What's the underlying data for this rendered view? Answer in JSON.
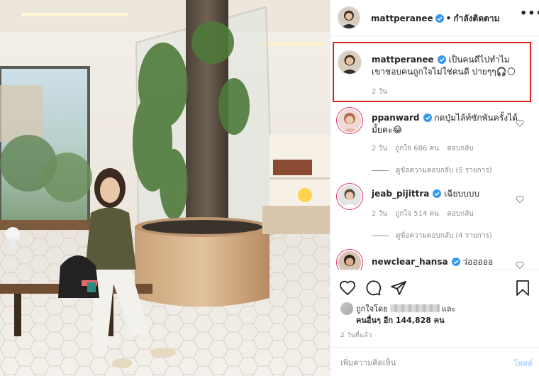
{
  "post": {
    "author": "mattperanee",
    "follow_status": "กำลังติดตาม",
    "more_glyph": "•••"
  },
  "comments": [
    {
      "username": "mattperanee",
      "text": "เป็นคนดีไปทำไม เขาชอบคนถูกใจไม่ใช่คนดี ปายๆๆ🎧🌕",
      "time": "2 วัน",
      "likes": "",
      "reply": "",
      "replies_label": ""
    },
    {
      "username": "ppanward",
      "text": "กดปุ่มไล้ท์ซักพันครั้งได้มั้ยคะ😂",
      "time": "2 วัน",
      "likes": "ถูกใจ 686 คน",
      "reply": "ตอบกลับ",
      "replies_label": "ดูข้อความตอบกลับ (5 รายการ)"
    },
    {
      "username": "jeab_pijittra",
      "text": "เฉียบบบบ",
      "time": "2 วัน",
      "likes": "ถูกใจ 514 คน",
      "reply": "ตอบกลับ",
      "replies_label": "ดูข้อความตอบกลับ (4 รายการ)"
    },
    {
      "username": "newclear_hansa",
      "text": "ว่อออออ",
      "time": "",
      "likes": "",
      "reply": "",
      "replies_label": ""
    }
  ],
  "likes": {
    "prefix": "ถูกใจโดย",
    "suffix": "และ",
    "others": "คนอื่นๆ อีก 144,828 คน"
  },
  "timestamp": "2 วันที่แล้ว",
  "add_comment": {
    "placeholder": "เพิ่มความคิดเห็น",
    "post_label": "โพสต์"
  },
  "colors": {
    "highlight_border": "#e0201b",
    "verified": "#3897f0",
    "post_button_disabled": "#b3dbff",
    "muted_text": "#8e8e8e"
  },
  "icons": [
    "more-options-icon",
    "verified-icon",
    "heart-icon",
    "comment-icon",
    "share-icon",
    "bookmark-icon"
  ]
}
